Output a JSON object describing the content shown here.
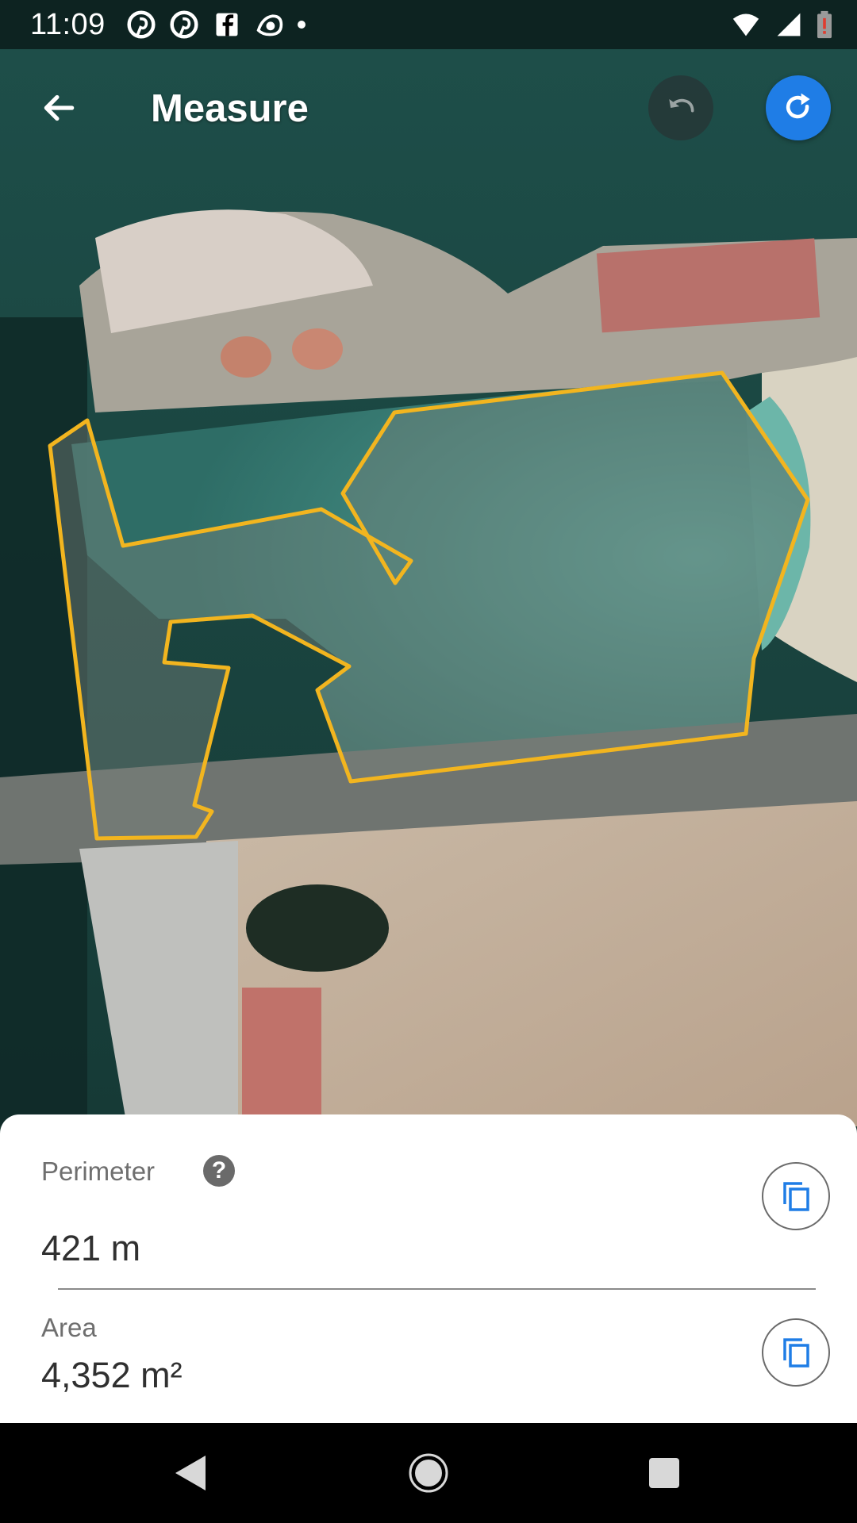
{
  "status_bar": {
    "time": "11:09",
    "left_icons": [
      "pinterest-icon",
      "pinterest-icon",
      "facebook-icon",
      "eye-icon",
      "dot-icon"
    ],
    "right_icons": [
      "wifi-icon",
      "cell-signal-icon",
      "battery-alert-icon"
    ]
  },
  "header": {
    "title": "Measure",
    "back_icon": "arrow-back-icon",
    "undo_icon": "undo-icon",
    "redo_icon": "redo-icon"
  },
  "map": {
    "polygon_color": "#f2b51f",
    "water_color": "#1d4a44"
  },
  "measurements": {
    "perimeter_label": "Perimeter",
    "perimeter_value": "421 m",
    "area_label": "Area",
    "area_value": "4,352 m²",
    "help_glyph": "?",
    "copy_icon": "copy-icon"
  },
  "nav_bar": {
    "back": "nav-back-icon",
    "home": "nav-home-icon",
    "recents": "nav-recents-icon"
  },
  "colors": {
    "accent": "#1f7de6",
    "sheet_bg": "#ffffff",
    "label_gray": "#6f6f6f",
    "value_dark": "#303030"
  }
}
